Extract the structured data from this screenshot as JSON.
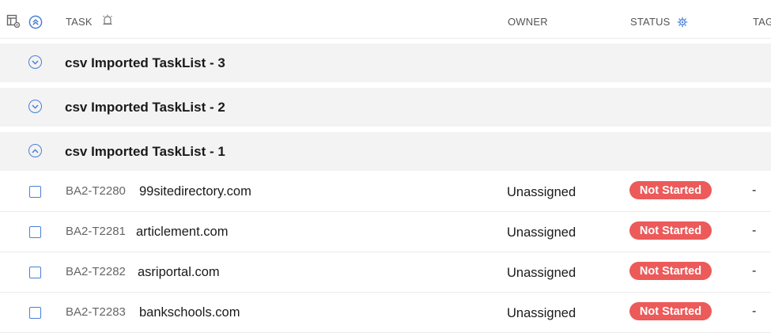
{
  "header": {
    "task_label": "TASK",
    "owner_label": "OWNER",
    "status_label": "STATUS",
    "tags_label": "TAG"
  },
  "groups": [
    {
      "title": "csv Imported TaskList - 3",
      "expanded": false
    },
    {
      "title": "csv Imported TaskList - 2",
      "expanded": false
    },
    {
      "title": "csv Imported TaskList - 1",
      "expanded": true
    }
  ],
  "tasks": [
    {
      "id": "BA2-T2280",
      "name": "99sitedirectory.com",
      "owner": "Unassigned",
      "status": "Not Started",
      "tags": "-"
    },
    {
      "id": "BA2-T2281",
      "name": "articlement.com",
      "owner": "Unassigned",
      "status": "Not Started",
      "tags": "-"
    },
    {
      "id": "BA2-T2282",
      "name": "asriportal.com",
      "owner": "Unassigned",
      "status": "Not Started",
      "tags": "-"
    },
    {
      "id": "BA2-T2283",
      "name": "bankschools.com",
      "owner": "Unassigned",
      "status": "Not Started",
      "tags": "-"
    }
  ],
  "colors": {
    "accent": "#4a7fd9",
    "status_not_started": "#ec5a5a",
    "group_bg": "#f3f3f3"
  }
}
